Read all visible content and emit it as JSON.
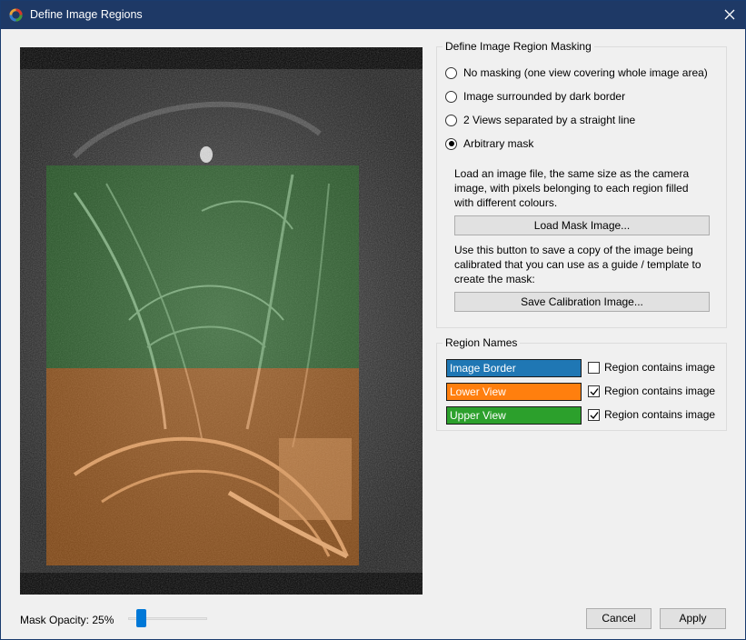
{
  "window": {
    "title": "Define Image Regions"
  },
  "masking": {
    "legend": "Define Image Region Masking",
    "options": [
      {
        "label": "No masking (one view covering whole image area)",
        "checked": false
      },
      {
        "label": "Image surrounded by dark border",
        "checked": false
      },
      {
        "label": "2 Views separated by a straight line",
        "checked": false
      },
      {
        "label": "Arbitrary mask",
        "checked": true
      }
    ],
    "load_desc": "Load an image file, the same size as the camera image, with pixels belonging to each region filled with different colours.",
    "load_button": "Load Mask Image...",
    "save_desc": "Use this button to save a copy of the image being calibrated that you can use as a guide / template to create the mask:",
    "save_button": "Save Calibration Image..."
  },
  "regions": {
    "legend": "Region Names",
    "items": [
      {
        "name": "Image Border",
        "color": "#1f77b4",
        "contains_image": false,
        "check_label": "Region contains image"
      },
      {
        "name": "Lower View",
        "color": "#ff7f0e",
        "contains_image": true,
        "check_label": "Region contains image"
      },
      {
        "name": "Upper View",
        "color": "#2ca02c",
        "contains_image": true,
        "check_label": "Region contains image"
      }
    ]
  },
  "footer": {
    "opacity_label": "Mask Opacity: 25%",
    "opacity_value": 0.25,
    "cancel_button": "Cancel",
    "apply_button": "Apply"
  },
  "colors": {
    "titlebar": "#1e3966",
    "mask_upper": "#2ca02c",
    "mask_lower": "#ff7f0e",
    "slider_thumb": "#0078d7"
  }
}
